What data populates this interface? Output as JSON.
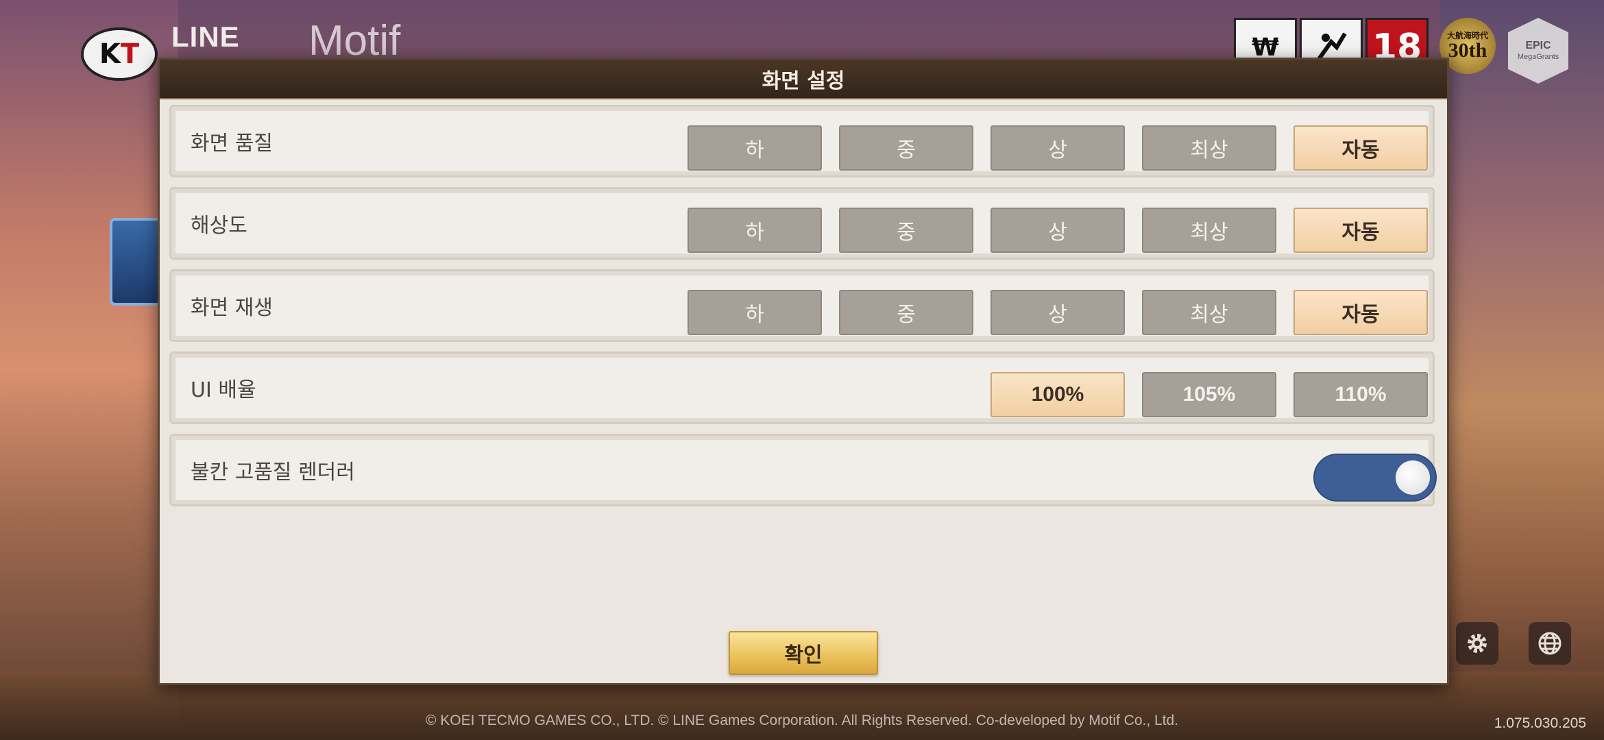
{
  "background": {
    "logos": {
      "kt": {
        "k": "K",
        "t": "T"
      },
      "line": "LINE",
      "motif": "Motif"
    },
    "badges": {
      "rating_1_icon": "money-bag-icon",
      "rating_2_icon": "violence-icon",
      "age": "18",
      "anniversary_small": "大航海時代",
      "anniversary_big": "30th",
      "epic_title": "EPIC",
      "epic_sub": "MegaGrants"
    },
    "copyright": "© KOEI TECMO GAMES CO., LTD. © LINE Games Corporation. All Rights Reserved. Co-developed by Motif Co., Ltd.",
    "version": "1.075.030.205"
  },
  "dialog": {
    "title": "화면 설정",
    "rows": [
      {
        "label": "화면 품질",
        "options": [
          "하",
          "중",
          "상",
          "최상",
          "자동"
        ],
        "selected": "자동"
      },
      {
        "label": "해상도",
        "options": [
          "하",
          "중",
          "상",
          "최상",
          "자동"
        ],
        "selected": "자동"
      },
      {
        "label": "화면 재생",
        "options": [
          "하",
          "중",
          "상",
          "최상",
          "자동"
        ],
        "selected": "자동"
      },
      {
        "label": "UI 배율",
        "options": [
          "100%",
          "105%",
          "110%"
        ],
        "selected": "100%"
      }
    ],
    "toggle_row": {
      "label": "불칸 고품질 렌더러",
      "enabled": true
    },
    "confirm_label": "확인"
  },
  "colors": {
    "selected": "#f2cfa4",
    "unselected": "#a7a099",
    "toggle_on": "#3d5f96",
    "confirm": "#eac15a"
  }
}
